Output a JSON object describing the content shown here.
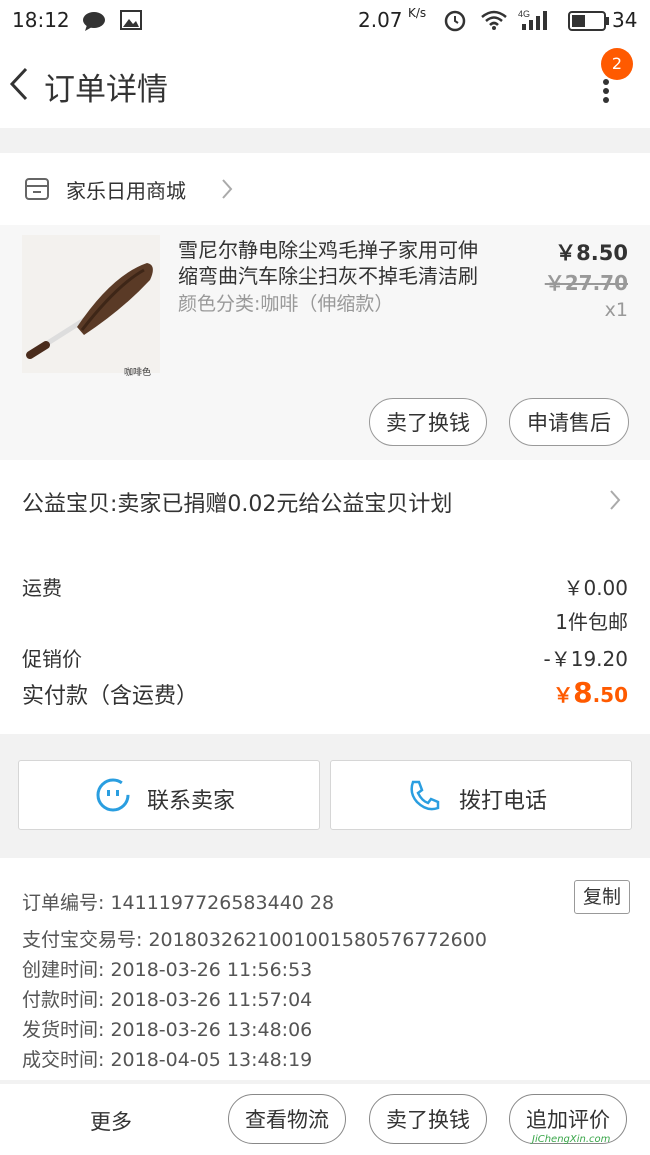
{
  "status": {
    "time": "18:12",
    "speed": "2.07",
    "speed_unit": "K/s",
    "battery": "34"
  },
  "header": {
    "title": "订单详情",
    "badge": "2"
  },
  "shop": {
    "name": "家乐日用商城"
  },
  "product": {
    "title_line1": "雪尼尔静电除尘鸡毛掸子家用可伸",
    "title_line2": "缩弯曲汽车除尘扫灰不掉毛清洁刷",
    "sku": "颜色分类:咖啡（伸缩款）",
    "price": "￥8.50",
    "original_price": "￥27.70",
    "quantity": "x1",
    "image_caption": "咖啡色",
    "actions": [
      "卖了换钱",
      "申请售后"
    ]
  },
  "charity": {
    "text": "公益宝贝:卖家已捐赠0.02元给公益宝贝计划"
  },
  "fees": {
    "shipping_label": "运费",
    "shipping_value": "￥0.00",
    "shipping_note": "1件包邮",
    "promo_label": "促销价",
    "promo_value": "-￥19.20",
    "paid_label": "实付款（含运费）",
    "paid_symbol": "￥",
    "paid_int": "8",
    "paid_dec": ".50",
    "accent_color": "#ff5a00"
  },
  "contact": {
    "seller": "联系卖家",
    "call": "拨打电话"
  },
  "order_info": {
    "order_no_label": "订单编号:",
    "order_no": "1411197726583440 28",
    "copy": "复制",
    "alipay_label": "支付宝交易号:",
    "alipay_no": "2018032621001001580576772600",
    "created_label": "创建时间:",
    "created": "2018-03-26 11:56:53",
    "paid_label": "付款时间:",
    "paid": "2018-03-26 11:57:04",
    "shipped_label": "发货时间:",
    "shipped": "2018-03-26 13:48:06",
    "closed_label": "成交时间:",
    "closed": "2018-04-05 13:48:19"
  },
  "bottom": {
    "more": "更多",
    "logistics": "查看物流",
    "sell": "卖了换钱",
    "review": "追加评价"
  },
  "watermark": "JiChengXin.com"
}
